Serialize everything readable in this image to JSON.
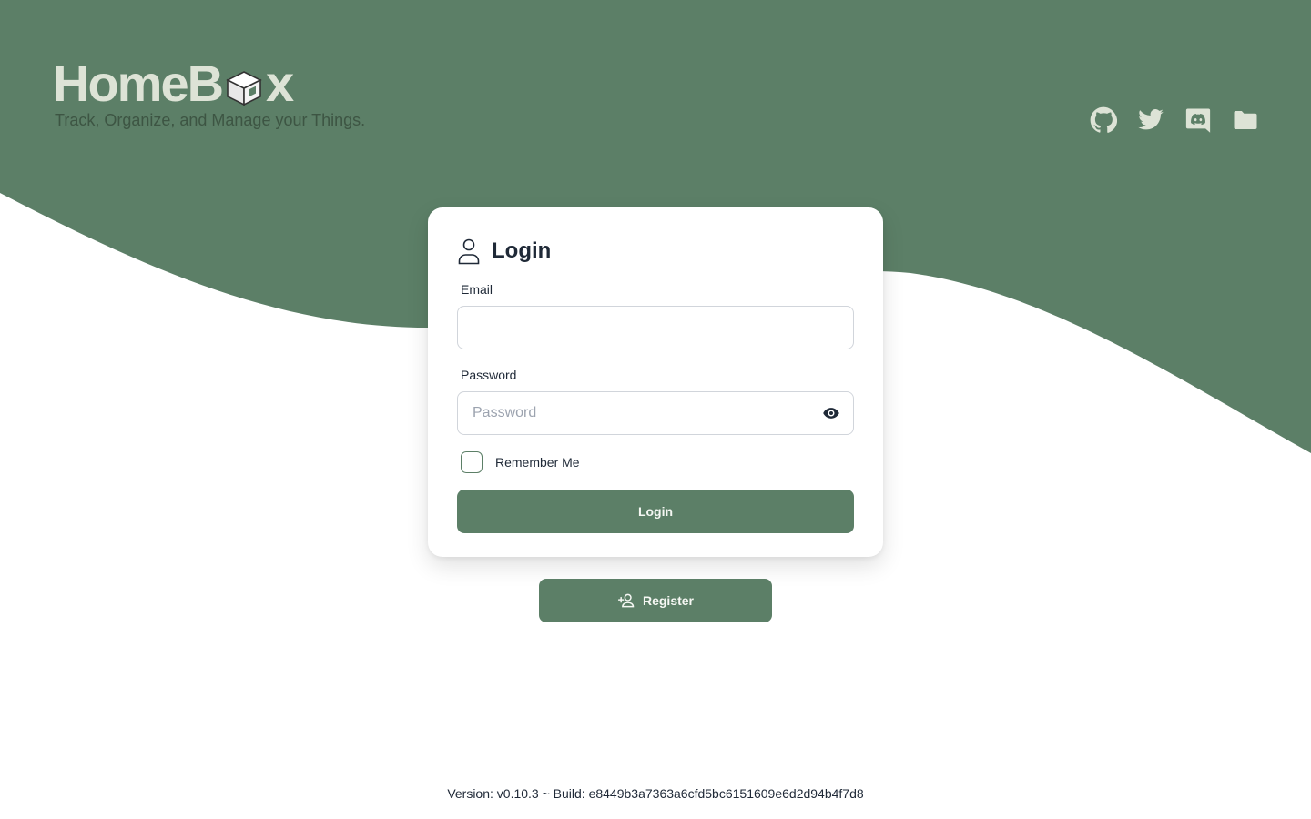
{
  "colors": {
    "brand": "#5c7f67",
    "logo_text": "#dde3d6",
    "tagline": "#3d5543",
    "background": "#ffffff"
  },
  "header": {
    "logo_text_before": "HomeB",
    "logo_text_after": "x",
    "tagline": "Track, Organize, and Manage your Things.",
    "social_icons": [
      "github-icon",
      "twitter-icon",
      "discord-icon",
      "folder-icon"
    ]
  },
  "login_card": {
    "title": "Login",
    "email_label": "Email",
    "email_value": "",
    "password_label": "Password",
    "password_placeholder": "Password",
    "password_value": "",
    "remember_label": "Remember Me",
    "remember_checked": false,
    "submit_label": "Login"
  },
  "register_button": {
    "label": "Register"
  },
  "footer": {
    "version_text": "Version: v0.10.3 ~ Build: e8449b3a7363a6cfd5bc6151609e6d2d94b4f7d8"
  }
}
